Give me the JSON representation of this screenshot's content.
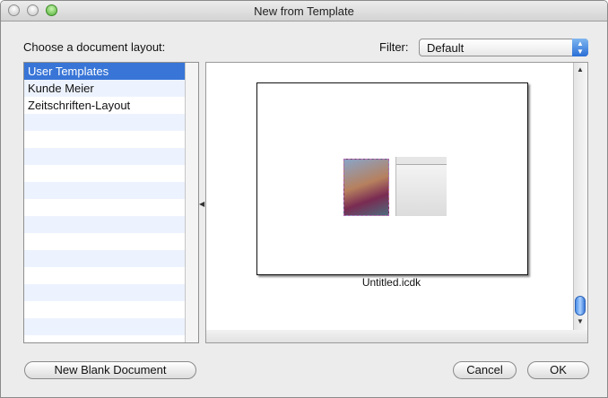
{
  "window": {
    "title": "New from Template"
  },
  "layout_chooser": {
    "label": "Choose a document layout:",
    "items": [
      {
        "label": "User Templates",
        "selected": true
      },
      {
        "label": "Kunde Meier",
        "selected": false
      },
      {
        "label": "Zeitschriften-Layout",
        "selected": false
      }
    ]
  },
  "filter": {
    "label": "Filter:",
    "value": "Default"
  },
  "preview": {
    "caption": "Untitled.icdk"
  },
  "buttons": {
    "new_blank": "New Blank Document",
    "cancel": "Cancel",
    "ok": "OK"
  },
  "colors": {
    "selection": "#3875d7",
    "row_alt": "#edf3fe",
    "zoom_button": "#4fae33"
  }
}
